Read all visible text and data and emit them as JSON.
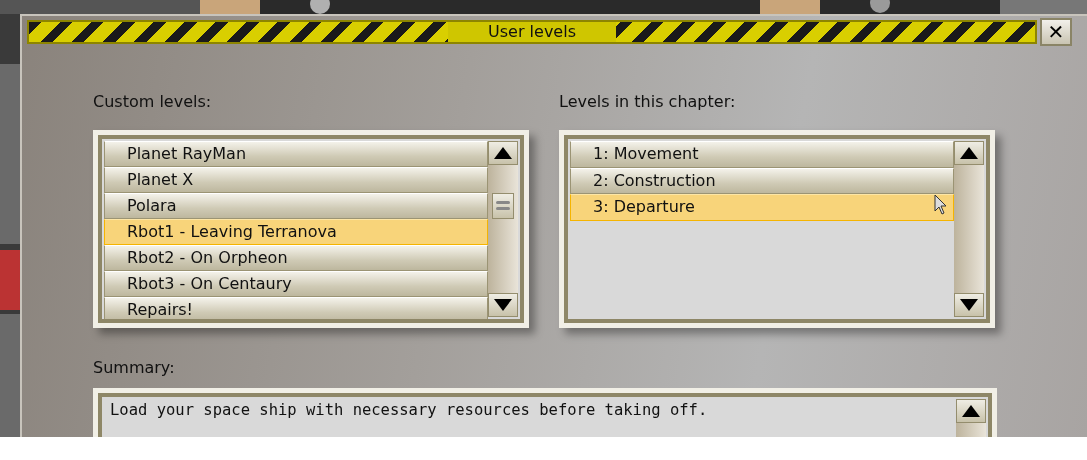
{
  "window": {
    "title": "User levels",
    "close": "✕"
  },
  "custom_levels": {
    "label": "Custom levels:",
    "items": [
      {
        "label": "Planet RayMan",
        "selected": false
      },
      {
        "label": "Planet X",
        "selected": false
      },
      {
        "label": "Polara",
        "selected": false
      },
      {
        "label": "Rbot1 - Leaving Terranova",
        "selected": true
      },
      {
        "label": "Rbot2 - On Orpheon",
        "selected": false
      },
      {
        "label": "Rbot3 - On Centaury",
        "selected": false
      },
      {
        "label": "Repairs!",
        "selected": false
      }
    ]
  },
  "chapter_levels": {
    "label": "Levels in this chapter:",
    "items": [
      {
        "label": "1: Movement",
        "selected": false
      },
      {
        "label": "2: Construction",
        "selected": false
      },
      {
        "label": "3: Departure",
        "selected": true
      }
    ]
  },
  "summary": {
    "label": "Summary:",
    "text": "Load your space ship with necessary resources before taking off."
  }
}
